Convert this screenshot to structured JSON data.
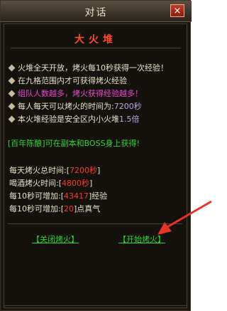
{
  "window": {
    "title": "对话"
  },
  "dialog": {
    "heading": "大火堆",
    "bullets": [
      {
        "text": "火堆全天开放，烤火每10秒获得一次经验！",
        "color": "white"
      },
      {
        "text": "在九格范围内才可获得烤火经验",
        "color": "white"
      },
      {
        "text": "组队人数越多，烤火获得经验越多！",
        "color": "pink"
      },
      {
        "pre": "每人每天可以烤火的时间为:",
        "val": "7200秒",
        "color": "white"
      },
      {
        "pre": "本火堆经验是安全区内小火堆",
        "val": "1.5倍",
        "color": "white"
      }
    ],
    "notice": "[百年陈酿]可在副本和BOSS身上获得!",
    "stats": [
      {
        "label": "每天烤火总时间:",
        "val": "7200秒",
        "suffix": ""
      },
      {
        "label": "喝酒烤火时间:",
        "val": "4800秒",
        "suffix": ""
      },
      {
        "label": "每10秒可增加:",
        "val": "43417",
        "suffix": "经验"
      },
      {
        "label": "每10秒可增加:",
        "val": "20",
        "suffix": "点真气"
      }
    ],
    "buttons": {
      "close": "【关闭烤火】",
      "start": "【开始烤火】"
    }
  },
  "icons": {
    "close": "×"
  },
  "colors": {
    "accent_red": "#ff3a2a",
    "green": "#2fd42f",
    "arrow": "#e8332a"
  }
}
